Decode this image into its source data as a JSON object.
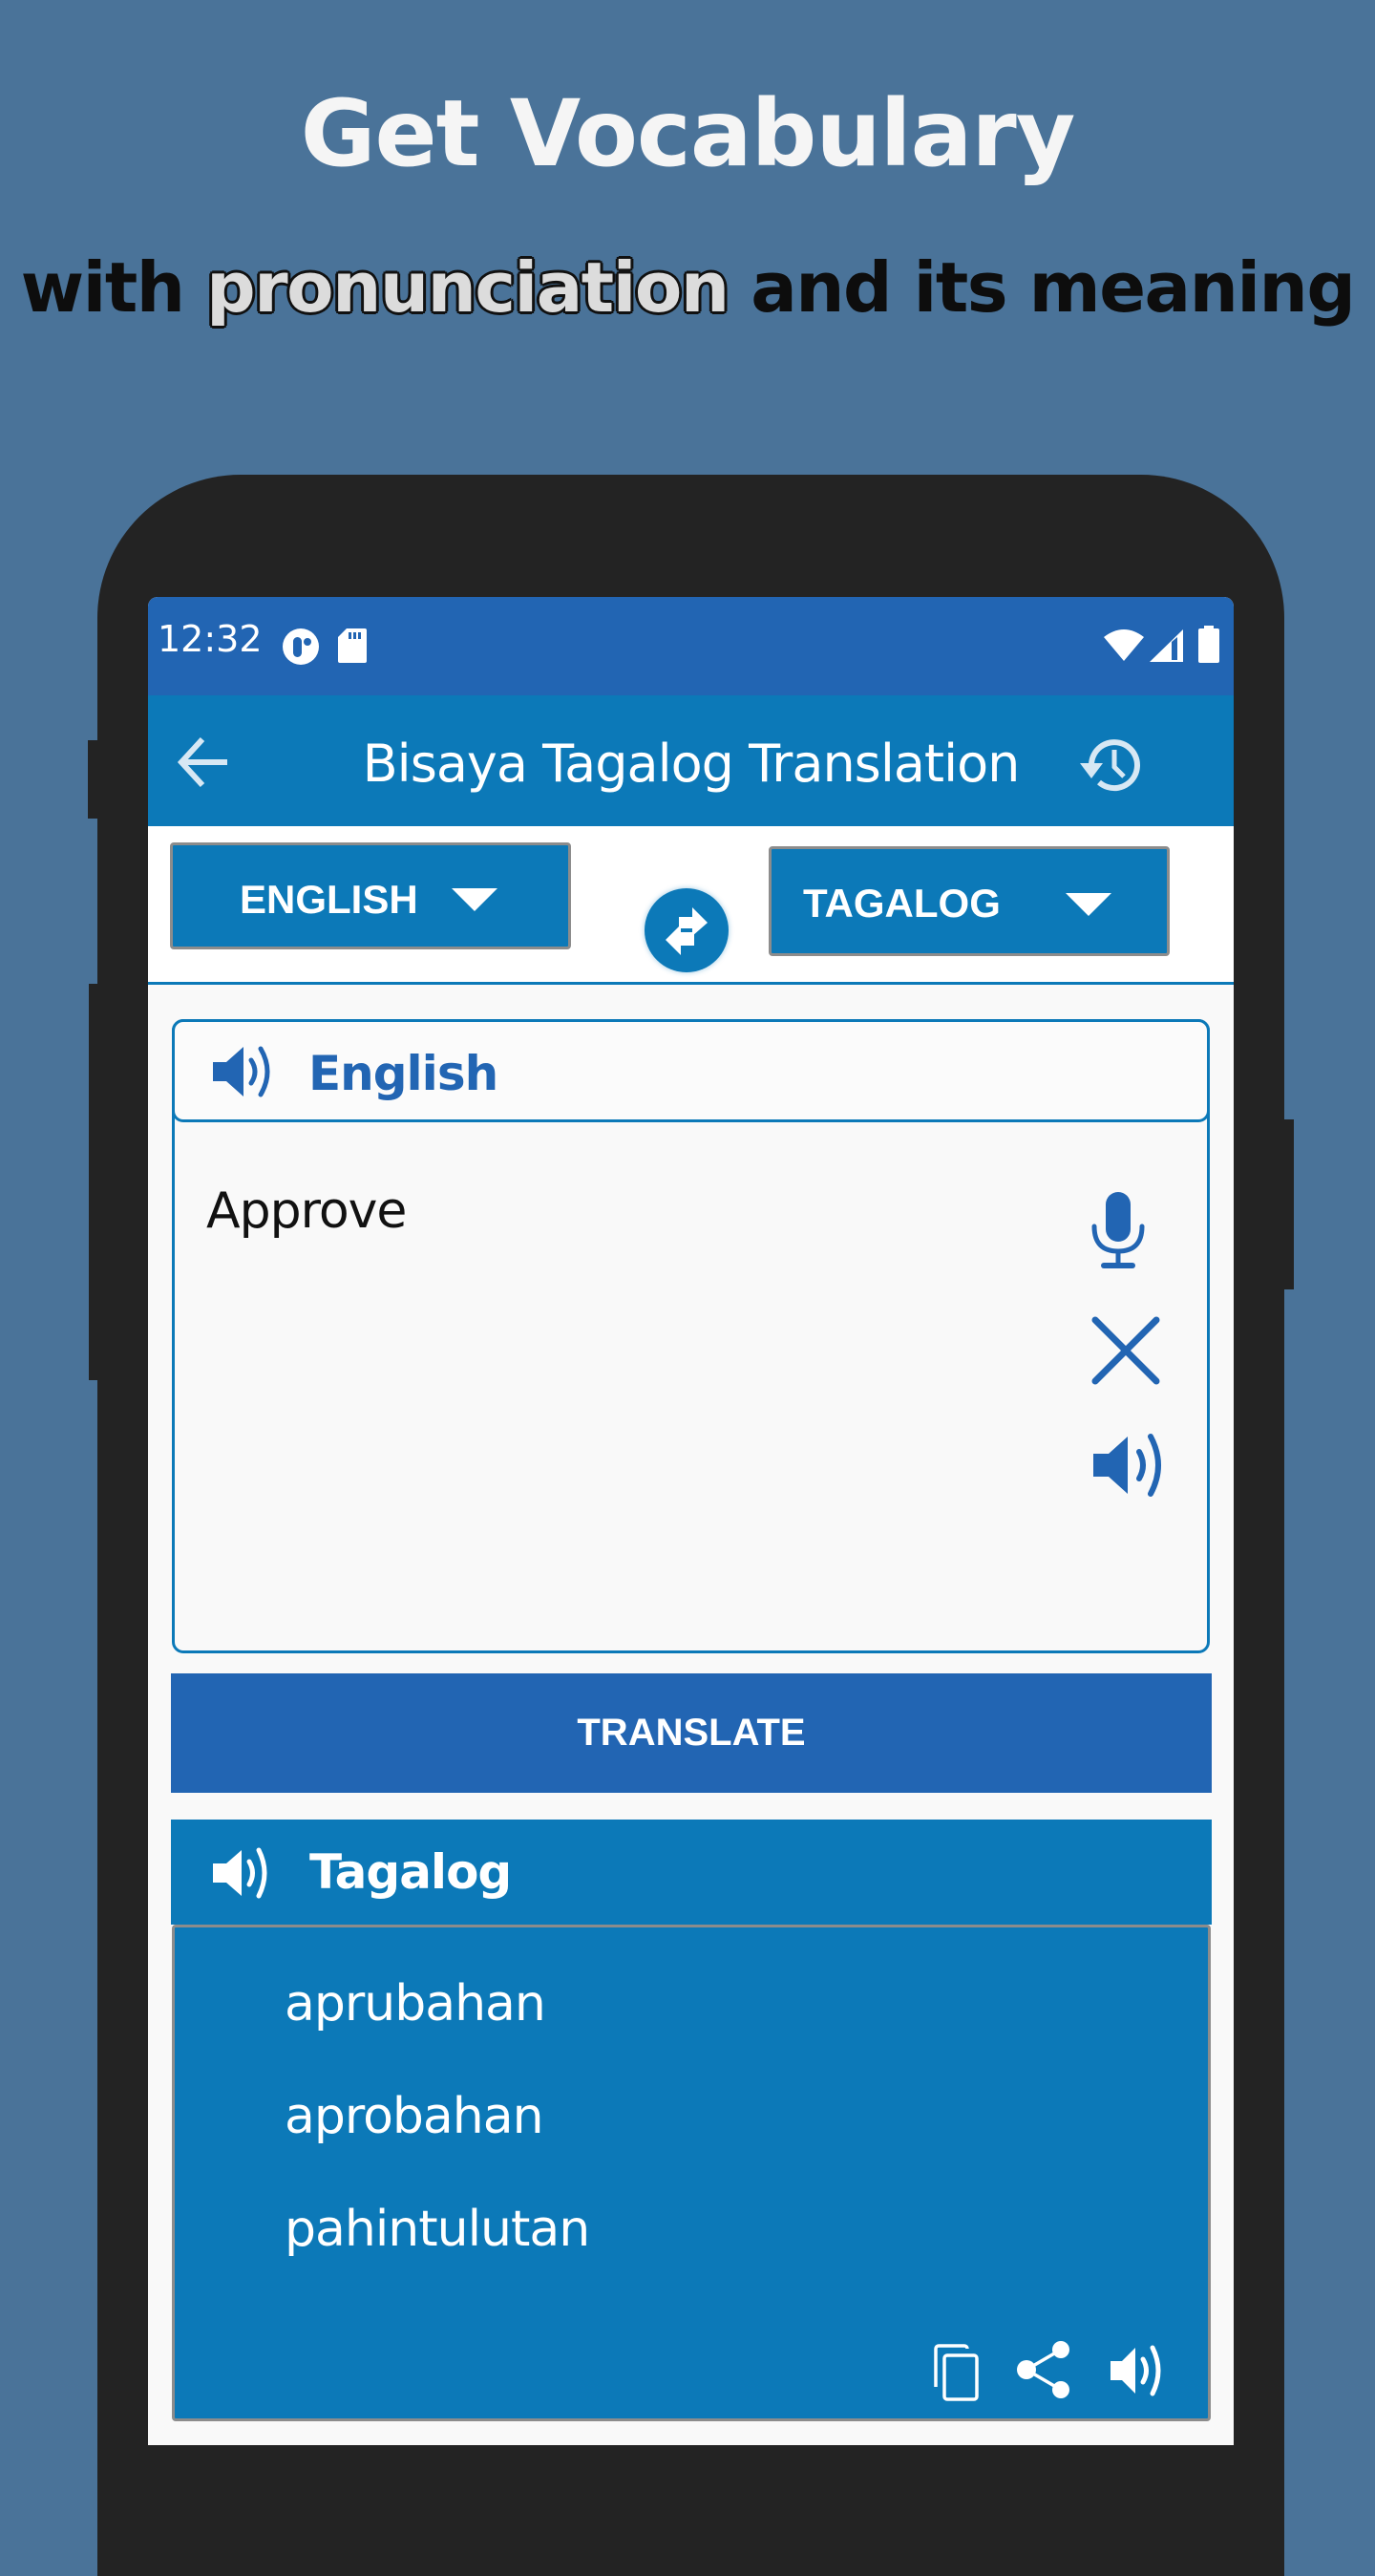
{
  "promo": {
    "title": "Get Vocabulary",
    "subtitle_pre": "with ",
    "subtitle_highlight": "pronunciation",
    "subtitle_post": " and its meaning"
  },
  "status_bar": {
    "time": "12:32",
    "left_icons": [
      "app-notification-icon",
      "sd-card-icon"
    ],
    "right_icons": [
      "wifi-icon",
      "cell-signal-icon",
      "battery-icon"
    ]
  },
  "app_bar": {
    "title": "Bisaya Tagalog Translation",
    "back_icon": "arrow-left-icon",
    "history_icon": "history-icon"
  },
  "language_selector": {
    "source": "ENGLISH",
    "target": "TAGALOG",
    "swap_icon": "swap-arrows-icon"
  },
  "input_card": {
    "header_label": "English",
    "text": "Approve",
    "tools": [
      "microphone-icon",
      "clear-icon",
      "speaker-icon"
    ]
  },
  "translate_button": "TRANSLATE",
  "output": {
    "header_label": "Tagalog",
    "results": [
      "aprubahan",
      "aprobahan",
      "pahintulutan"
    ],
    "actions": [
      "copy-icon",
      "share-icon",
      "speaker-icon"
    ]
  },
  "colors": {
    "background": "#4a7399",
    "status_bar": "#2265b3",
    "primary": "#0c79b8",
    "translate_button": "#2265b3",
    "bezel": "#232323"
  }
}
